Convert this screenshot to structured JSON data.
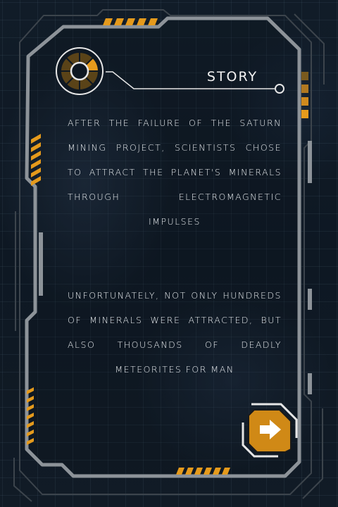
{
  "story": {
    "title": "STORY",
    "paragraphs": [
      "AFTER THE FAILURE OF THE SATURN MINING PROJECT, SCIENTISTS CHOSE TO ATTRACT THE PLANET'S MINERALS THROUGH ELECTROMAGNETIC IMPULSES",
      "UNFORTUNATELY, NOT ONLY HUNDREDS OF MINERALS WERE ATTRACTED, BUT ALSO THOUSANDS OF DEADLY METEORITES FOR MAN"
    ]
  },
  "next_button": {
    "icon": "arrow-right-icon"
  },
  "colors": {
    "accent": "#e59a1c",
    "frame": "#8d9399",
    "frame_dark": "#3c444c",
    "text": "#e9edf0",
    "background": "#0d1620"
  }
}
